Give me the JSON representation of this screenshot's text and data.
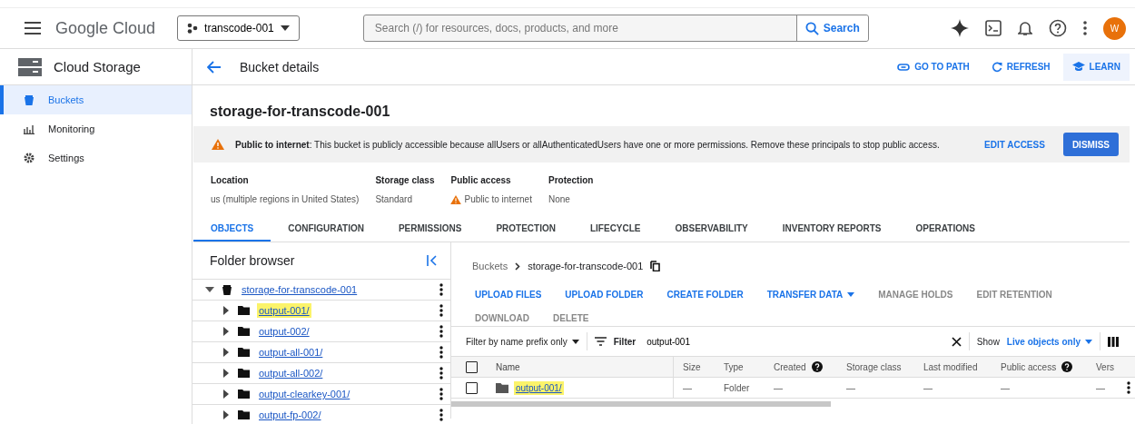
{
  "top_bar": {
    "product": "Google Cloud",
    "project": "transcode-001",
    "search_placeholder": "Search (/) for resources, docs, products, and more",
    "search_button": "Search",
    "avatar": "W"
  },
  "sidebar": {
    "title": "Cloud Storage",
    "items": [
      {
        "label": "Buckets",
        "selected": true
      },
      {
        "label": "Monitoring",
        "selected": false
      },
      {
        "label": "Settings",
        "selected": false
      }
    ]
  },
  "page_header": {
    "title": "Bucket details",
    "actions": [
      {
        "label": "GO TO PATH",
        "highlighted": false
      },
      {
        "label": "REFRESH",
        "highlighted": false
      },
      {
        "label": "LEARN",
        "highlighted": true
      }
    ]
  },
  "bucket_name": "storage-for-transcode-001",
  "banner": {
    "title": "Public to internet",
    "text": ": This bucket is publicly accessible because allUsers or allAuthenticatedUsers have one or more permissions. Remove these principals to stop public access.",
    "link": "EDIT ACCESS",
    "button": "DISMISS"
  },
  "details": [
    {
      "label": "Location",
      "value": "us (multiple regions in United States)",
      "warning": false
    },
    {
      "label": "Storage class",
      "value": "Standard",
      "warning": false
    },
    {
      "label": "Public access",
      "value": "Public to internet",
      "warning": true
    },
    {
      "label": "Protection",
      "value": "None",
      "warning": false
    }
  ],
  "tabs": [
    {
      "label": "OBJECTS",
      "selected": true
    },
    {
      "label": "CONFIGURATION",
      "selected": false
    },
    {
      "label": "PERMISSIONS",
      "selected": false
    },
    {
      "label": "PROTECTION",
      "selected": false
    },
    {
      "label": "LIFECYCLE",
      "selected": false
    },
    {
      "label": "OBSERVABILITY",
      "selected": false
    },
    {
      "label": "INVENTORY REPORTS",
      "selected": false
    },
    {
      "label": "OPERATIONS",
      "selected": false
    }
  ],
  "folder_browser": {
    "title": "Folder browser",
    "tree": [
      {
        "label": "storage-for-transcode-001",
        "expanded": true,
        "kind": "bucket",
        "highlighted": false,
        "children": [
          {
            "label": "output-001/",
            "expanded": false,
            "kind": "folder",
            "highlighted": true
          },
          {
            "label": "output-002/",
            "expanded": false,
            "kind": "folder",
            "highlighted": false
          },
          {
            "label": "output-all-001/",
            "expanded": false,
            "kind": "folder",
            "highlighted": false
          },
          {
            "label": "output-all-002/",
            "expanded": false,
            "kind": "folder",
            "highlighted": false
          },
          {
            "label": "output-clearkey-001/",
            "expanded": false,
            "kind": "folder",
            "highlighted": false
          },
          {
            "label": "output-fp-002/",
            "expanded": false,
            "kind": "folder",
            "highlighted": false
          }
        ]
      }
    ]
  },
  "objects": {
    "breadcrumb": [
      "Buckets",
      "storage-for-transcode-001"
    ],
    "actions": [
      {
        "label": "UPLOAD FILES",
        "disabled": false,
        "dropdown": false
      },
      {
        "label": "UPLOAD FOLDER",
        "disabled": false,
        "dropdown": false
      },
      {
        "label": "CREATE FOLDER",
        "disabled": false,
        "dropdown": false
      },
      {
        "label": "TRANSFER DATA",
        "disabled": false,
        "dropdown": true
      },
      {
        "label": "MANAGE HOLDS",
        "disabled": true,
        "dropdown": false
      },
      {
        "label": "EDIT RETENTION",
        "disabled": true,
        "dropdown": false
      },
      {
        "label": "DOWNLOAD",
        "disabled": true,
        "dropdown": false
      },
      {
        "label": "DELETE",
        "disabled": true,
        "dropdown": false
      }
    ],
    "filter_mode": "Filter by name prefix only",
    "filter_label": "Filter",
    "filter_value": "output-001",
    "show_label": "Show",
    "show_value": "Live objects only",
    "table": {
      "select_all_checked": false,
      "columns": [
        {
          "label": "Name",
          "help": false
        },
        {
          "label": "Size",
          "help": false
        },
        {
          "label": "Type",
          "help": false
        },
        {
          "label": "Created",
          "help": true
        },
        {
          "label": "Storage class",
          "help": false
        },
        {
          "label": "Last modified",
          "help": false
        },
        {
          "label": "Public access",
          "help": true
        },
        {
          "label": "Vers",
          "help": false
        }
      ],
      "rows": [
        {
          "checked": false,
          "highlighted": true,
          "cells": [
            "output-001/",
            "—",
            "Folder",
            "—",
            "—",
            "—",
            "—",
            "—"
          ]
        }
      ]
    }
  }
}
